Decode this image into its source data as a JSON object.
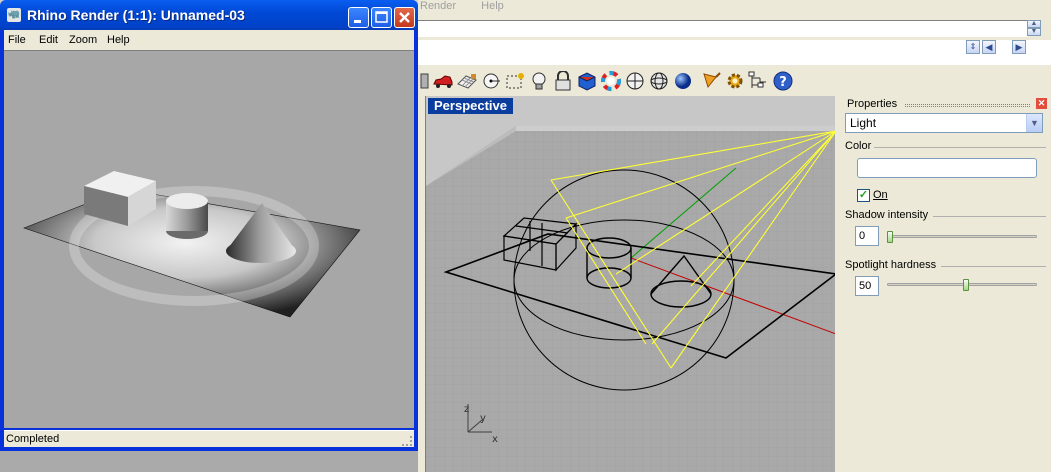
{
  "main": {
    "menu": [
      "Render",
      "Help"
    ],
    "viewport_title": "Perspective",
    "axis": {
      "z": "z",
      "y": "y",
      "x": "x"
    }
  },
  "toolbar": {
    "icons": [
      "layer-icon",
      "car-icon",
      "grid-plane-icon",
      "point-snap-icon",
      "osnap-icon",
      "bulb-icon",
      "lock-icon",
      "properties-icon",
      "color-wheel-icon",
      "shaded-sphere-icon",
      "wire-sphere-icon",
      "render-sphere-icon",
      "spotlight-icon",
      "gear-icon",
      "tree-icon",
      "help-icon"
    ]
  },
  "properties": {
    "title": "Properties",
    "object_type": "Light",
    "color_label": "Color",
    "color_value": "#ffffff",
    "on_label": "On",
    "on_checked": true,
    "shadow_label": "Shadow intensity",
    "shadow_value": "0",
    "shadow_fraction": 0,
    "spot_label": "Spotlight hardness",
    "spot_value": "50",
    "spot_fraction": 0.5
  },
  "render_window": {
    "title": "Rhino Render (1:1): Unnamed-03",
    "menu": [
      "File",
      "Edit",
      "Zoom",
      "Help"
    ],
    "status": "Completed"
  },
  "colors": {
    "titlebar": "#0054e3",
    "viewport_label_bg": "#0a3d9e",
    "wire": "#000000",
    "light_wire": "#ffff33",
    "x_axis": "#c00000",
    "y_axis": "#00a000"
  }
}
